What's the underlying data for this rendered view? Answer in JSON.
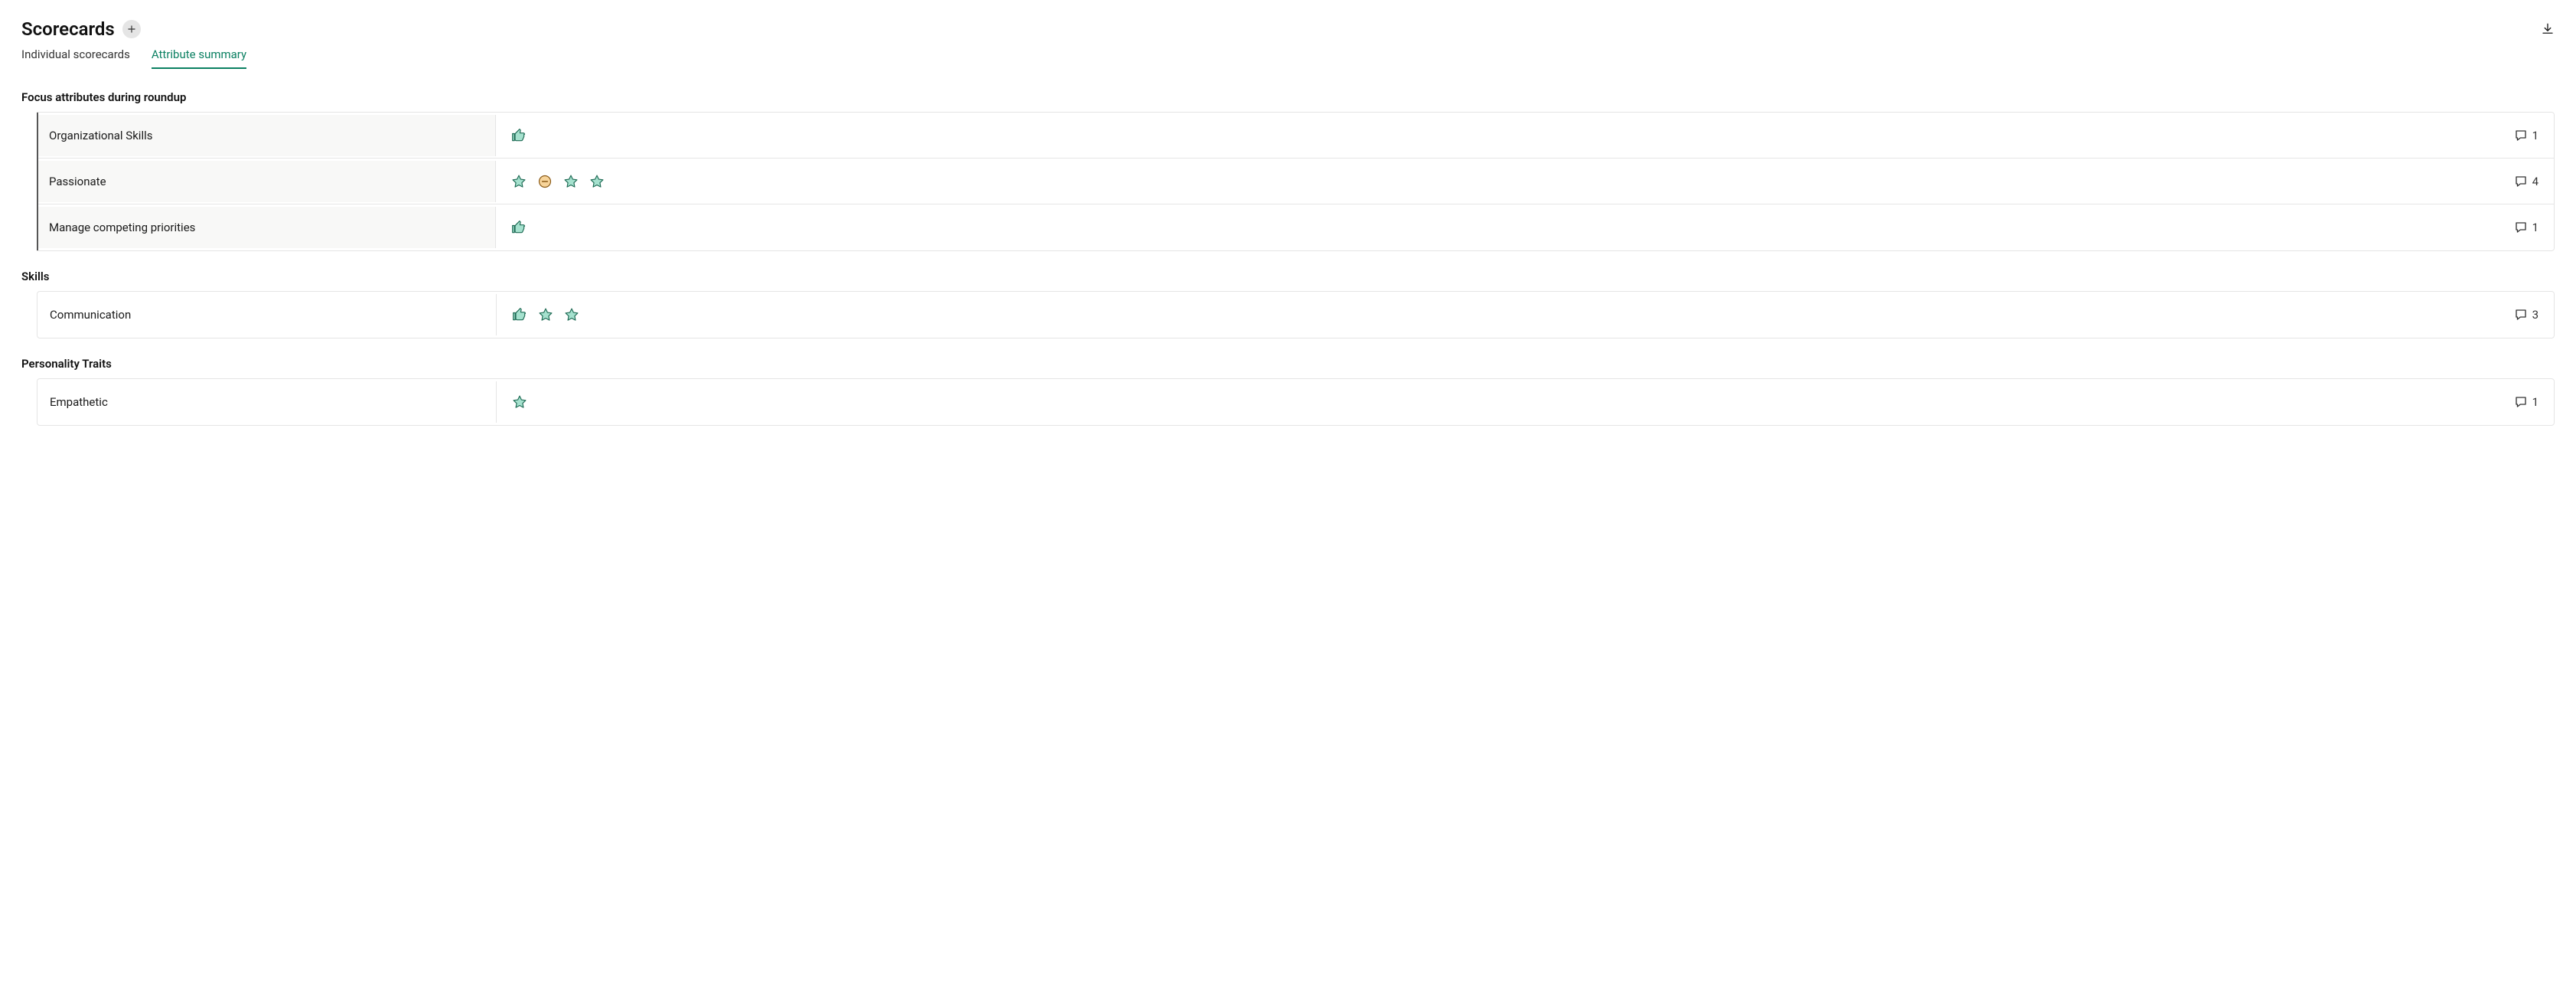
{
  "header": {
    "title": "Scorecards"
  },
  "tabs": {
    "individual": "Individual scorecards",
    "summary": "Attribute summary"
  },
  "sections": {
    "focus": {
      "title": "Focus attributes during roundup",
      "rows": {
        "org": {
          "name": "Organizational Skills",
          "comments": "1"
        },
        "passionate": {
          "name": "Passionate",
          "comments": "4"
        },
        "manage": {
          "name": "Manage competing priorities",
          "comments": "1"
        }
      }
    },
    "skills": {
      "title": "Skills",
      "rows": {
        "communication": {
          "name": "Communication",
          "comments": "3"
        }
      }
    },
    "personality": {
      "title": "Personality Traits",
      "rows": {
        "empathetic": {
          "name": "Empathetic",
          "comments": "1"
        }
      }
    }
  }
}
